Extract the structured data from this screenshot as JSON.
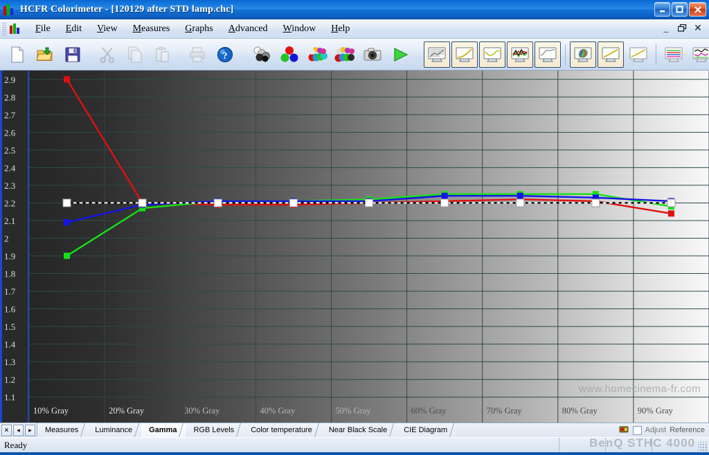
{
  "window": {
    "app_title": "HCFR Colorimeter - [120129 after STD lamp.chc]",
    "logo_icon": "rgb-bars-icon",
    "minimize_icon": "minimize-icon",
    "maximize_icon": "maximize-icon",
    "close_icon": "close-icon"
  },
  "menu": {
    "items": [
      {
        "label": "File",
        "accel": "F"
      },
      {
        "label": "Edit",
        "accel": "E"
      },
      {
        "label": "View",
        "accel": "V"
      },
      {
        "label": "Measures",
        "accel": "M"
      },
      {
        "label": "Graphs",
        "accel": "G"
      },
      {
        "label": "Advanced",
        "accel": "A"
      },
      {
        "label": "Window",
        "accel": "W"
      },
      {
        "label": "Help",
        "accel": "H"
      }
    ],
    "mdi": {
      "minimize": "_",
      "restore": "❐",
      "close": "✕"
    }
  },
  "toolbar": {
    "groups": [
      {
        "name": "file-group",
        "buttons": [
          {
            "icon": "new-document-icon",
            "enabled": true,
            "pressed": false
          },
          {
            "icon": "open-folder-icon",
            "enabled": true,
            "pressed": false
          },
          {
            "icon": "save-disk-icon",
            "enabled": true,
            "pressed": false
          }
        ]
      },
      {
        "name": "edit-group",
        "buttons": [
          {
            "icon": "cut-scissors-icon",
            "enabled": false,
            "pressed": false
          },
          {
            "icon": "copy-icon",
            "enabled": false,
            "pressed": false
          },
          {
            "icon": "paste-icon",
            "enabled": false,
            "pressed": false
          }
        ]
      },
      {
        "name": "print-help-group",
        "buttons": [
          {
            "icon": "print-icon",
            "enabled": false,
            "pressed": false
          },
          {
            "icon": "help-question-icon",
            "enabled": true,
            "pressed": false
          }
        ]
      },
      {
        "name": "measure-group",
        "buttons": [
          {
            "icon": "grayscale-spheres-icon",
            "enabled": true,
            "pressed": false
          },
          {
            "icon": "primary-colors-icon",
            "enabled": true,
            "pressed": false
          },
          {
            "icon": "saturation-sweep-icon",
            "enabled": true,
            "pressed": false
          },
          {
            "icon": "full-measure-icon",
            "enabled": true,
            "pressed": false
          },
          {
            "icon": "camera-icon",
            "enabled": true,
            "pressed": false
          },
          {
            "icon": "run-play-icon",
            "enabled": true,
            "pressed": false
          }
        ]
      },
      {
        "name": "graph-view-group",
        "buttons": [
          {
            "icon": "measures-table-view-icon",
            "enabled": true,
            "pressed": true
          },
          {
            "icon": "luminance-graph-icon",
            "enabled": true,
            "pressed": true
          },
          {
            "icon": "gamma-graph-icon",
            "enabled": true,
            "pressed": true
          },
          {
            "icon": "rgb-levels-graph-icon",
            "enabled": true,
            "pressed": true
          },
          {
            "icon": "color-temperature-graph-icon",
            "enabled": true,
            "pressed": true
          },
          {
            "icon": "cie-diagram-icon",
            "enabled": true,
            "pressed": true
          },
          {
            "icon": "near-black-scale-icon",
            "enabled": true,
            "pressed": true
          },
          {
            "icon": "luminance-curve-icon",
            "enabled": true,
            "pressed": false
          },
          {
            "icon": "rgb-levels-alt-icon",
            "enabled": true,
            "pressed": false
          },
          {
            "icon": "color-temp-alt-icon",
            "enabled": true,
            "pressed": false
          }
        ]
      }
    ]
  },
  "chart_data": {
    "type": "line",
    "title": "",
    "xlabel": "",
    "ylabel": "",
    "grid": true,
    "legend_position": "none",
    "categories": [
      "10% Gray",
      "20% Gray",
      "30% Gray",
      "40% Gray",
      "50% Gray",
      "60% Gray",
      "70% Gray",
      "80% Gray",
      "90% Gray"
    ],
    "x": [
      10,
      20,
      30,
      40,
      50,
      60,
      70,
      80,
      90
    ],
    "ylim": [
      1.05,
      2.95
    ],
    "yticks": [
      2.9,
      2.8,
      2.7,
      2.6,
      2.5,
      2.4,
      2.3,
      2.2,
      2.1,
      2,
      1.9,
      1.8,
      1.7,
      1.6,
      1.5,
      1.4,
      1.3,
      1.2,
      1.1
    ],
    "series": [
      {
        "name": "Red",
        "color": "#e01010",
        "marker": "square",
        "values": [
          2.9,
          2.2,
          2.19,
          2.19,
          2.2,
          2.21,
          2.22,
          2.21,
          2.14
        ]
      },
      {
        "name": "Green",
        "color": "#16e016",
        "marker": "square",
        "values": [
          1.9,
          2.17,
          2.21,
          2.21,
          2.22,
          2.25,
          2.25,
          2.25,
          2.18
        ]
      },
      {
        "name": "Blue",
        "color": "#1414e6",
        "marker": "square",
        "values": [
          2.09,
          2.19,
          2.21,
          2.21,
          2.21,
          2.24,
          2.24,
          2.23,
          2.21
        ]
      },
      {
        "name": "Reference",
        "color": "#ffffff",
        "marker": "square",
        "dashed": true,
        "values": [
          2.2,
          2.2,
          2.2,
          2.2,
          2.2,
          2.2,
          2.2,
          2.2,
          2.2
        ]
      }
    ],
    "background": "horizontal grayscale gradient dark-to-light",
    "gridline_color": "#2f4a48",
    "watermark": "www.homecinema-fr.com"
  },
  "tabs": {
    "nav": {
      "close": "✕",
      "prev": "◂",
      "next": "▸"
    },
    "items": [
      {
        "label": "Measures",
        "active": false
      },
      {
        "label": "Luminance",
        "active": false
      },
      {
        "label": "Gamma",
        "active": true
      },
      {
        "label": "RGB Levels",
        "active": false
      },
      {
        "label": "Color temperature",
        "active": false
      },
      {
        "label": "Near Black Scale",
        "active": false
      },
      {
        "label": "CIE Diagram",
        "active": false
      }
    ],
    "adjust_label": "Adjust",
    "reference_label": "Reference",
    "settings_icon": "target-settings-icon"
  },
  "status": {
    "message": "Ready",
    "watermark": "BenQ STHC 4000"
  }
}
